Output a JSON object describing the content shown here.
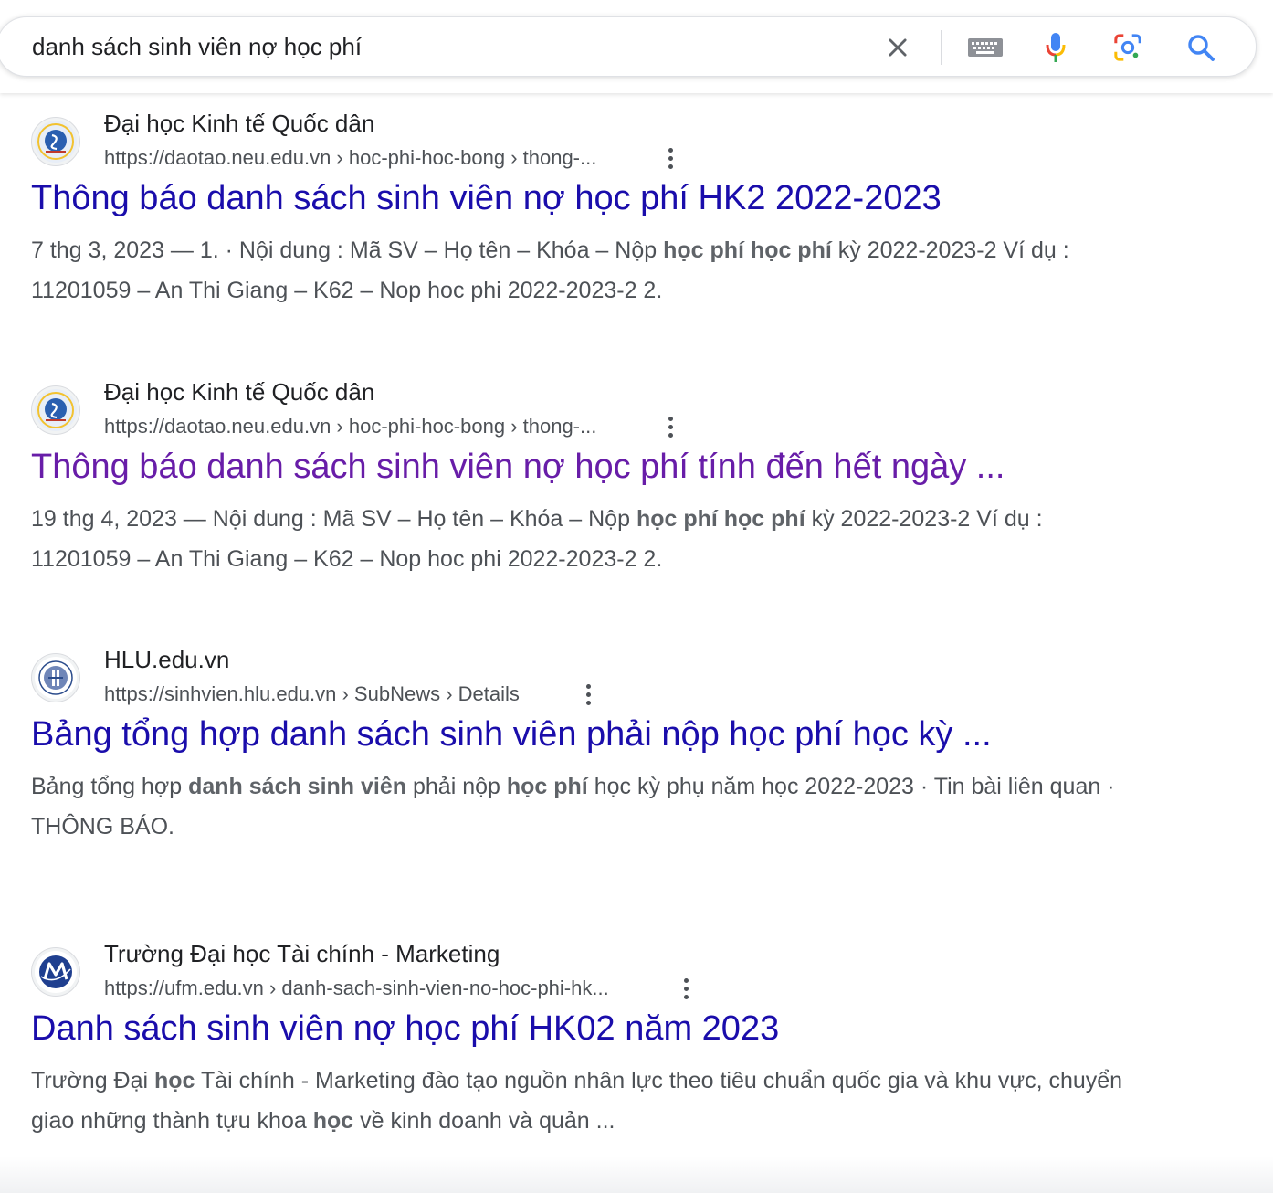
{
  "search": {
    "query": "danh sách sinh viên nợ học phí",
    "icons": [
      "close-icon",
      "keyboard-icon",
      "microphone-icon",
      "google-lens-icon",
      "search-icon"
    ]
  },
  "results": [
    {
      "site_name": "Đại học Kinh tế Quốc dân",
      "url": "https://daotao.neu.edu.vn › hoc-phi-hoc-bong › thong-...",
      "title": "Thông báo danh sách sinh viên nợ học phí HK2 2022-2023",
      "visited": false,
      "snippet": [
        {
          "t": "7 thg 3, 2023 — 1. · Nội dung : Mã SV – Họ tên – Khóa – Nộp ",
          "b": false
        },
        {
          "t": "học phí học phí",
          "b": true
        },
        {
          "t": " kỳ 2022-2023-2 Ví dụ : 11201059 – An Thi Giang – K62 – Nop hoc phi 2022-2023-2 2.",
          "b": false
        }
      ]
    },
    {
      "site_name": "Đại học Kinh tế Quốc dân",
      "url": "https://daotao.neu.edu.vn › hoc-phi-hoc-bong › thong-...",
      "title": "Thông báo danh sách sinh viên nợ học phí tính đến hết ngày ...",
      "visited": true,
      "snippet": [
        {
          "t": "19 thg 4, 2023 — Nội dung : Mã SV – Họ tên – Khóa – Nộp ",
          "b": false
        },
        {
          "t": "học phí học phí",
          "b": true
        },
        {
          "t": " kỳ 2022-2023-2 Ví dụ : 11201059 – An Thi Giang – K62 – Nop hoc phi 2022-2023-2 2.",
          "b": false
        }
      ]
    },
    {
      "site_name": "HLU.edu.vn",
      "url": "https://sinhvien.hlu.edu.vn › SubNews › Details",
      "title": "Bảng tổng hợp danh sách sinh viên phải nộp học phí học kỳ ...",
      "visited": false,
      "snippet": [
        {
          "t": "Bảng tổng hợp ",
          "b": false
        },
        {
          "t": "danh sách sinh viên",
          "b": true
        },
        {
          "t": " phải nộp ",
          "b": false
        },
        {
          "t": "học phí",
          "b": true
        },
        {
          "t": " học kỳ phụ năm học 2022-2023 · Tin bài liên quan · THÔNG BÁO.",
          "b": false
        }
      ]
    },
    {
      "site_name": "Trường Đại học Tài chính - Marketing",
      "url": "https://ufm.edu.vn › danh-sach-sinh-vien-no-hoc-phi-hk...",
      "title": "Danh sách sinh viên nợ học phí HK02 năm 2023",
      "visited": false,
      "snippet": [
        {
          "t": "Trường Đại ",
          "b": false
        },
        {
          "t": "học",
          "b": true
        },
        {
          "t": " Tài chính - Marketing đào tạo nguồn nhân lực theo tiêu chuẩn quốc gia và khu vực, chuyển giao những thành tựu khoa ",
          "b": false
        },
        {
          "t": "học",
          "b": true
        },
        {
          "t": " về kinh doanh và quản ...",
          "b": false
        }
      ]
    }
  ],
  "colors": {
    "link": "#1a0dab",
    "visited_link": "#681da8",
    "snippet_text": "#4d5156",
    "google_blue": "#4285f4",
    "google_red": "#ea4335",
    "google_yellow": "#fbbc05",
    "google_green": "#34a853"
  }
}
